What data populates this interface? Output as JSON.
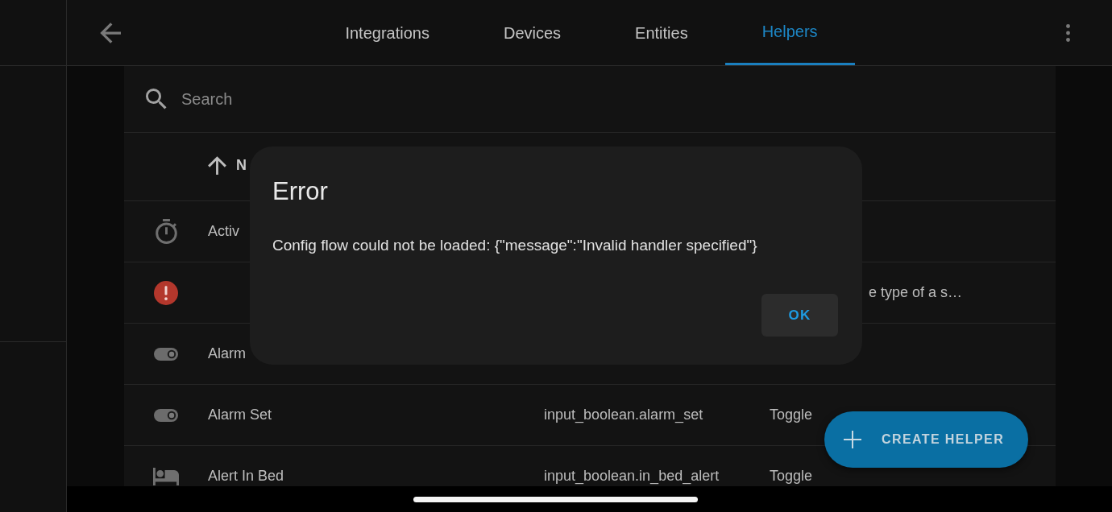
{
  "top_bar": {
    "tabs": [
      {
        "label": "Integrations",
        "selected": false
      },
      {
        "label": "Devices",
        "selected": false
      },
      {
        "label": "Entities",
        "selected": false
      },
      {
        "label": "Helpers",
        "selected": true
      }
    ]
  },
  "search": {
    "placeholder": "Search"
  },
  "table": {
    "columns": [
      {
        "label": "N",
        "sort_ascending": true
      }
    ],
    "rows": [
      {
        "kind": "timer",
        "name": "Activ"
      },
      {
        "kind": "error",
        "description": "e type of a s…"
      },
      {
        "kind": "toggle",
        "name": "Alarm"
      },
      {
        "kind": "toggle",
        "name": "Alarm Set",
        "entity_id": "input_boolean.alarm_set",
        "type": "Toggle"
      },
      {
        "kind": "bed",
        "name": "Alert In Bed",
        "entity_id": "input_boolean.in_bed_alert",
        "type": "Toggle"
      }
    ]
  },
  "dialog": {
    "title": "Error",
    "message": "Config flow could not be loaded: {\"message\":\"Invalid handler specified\"}",
    "buttons": [
      "OK"
    ]
  },
  "fab": {
    "label": "CREATE HELPER"
  }
}
